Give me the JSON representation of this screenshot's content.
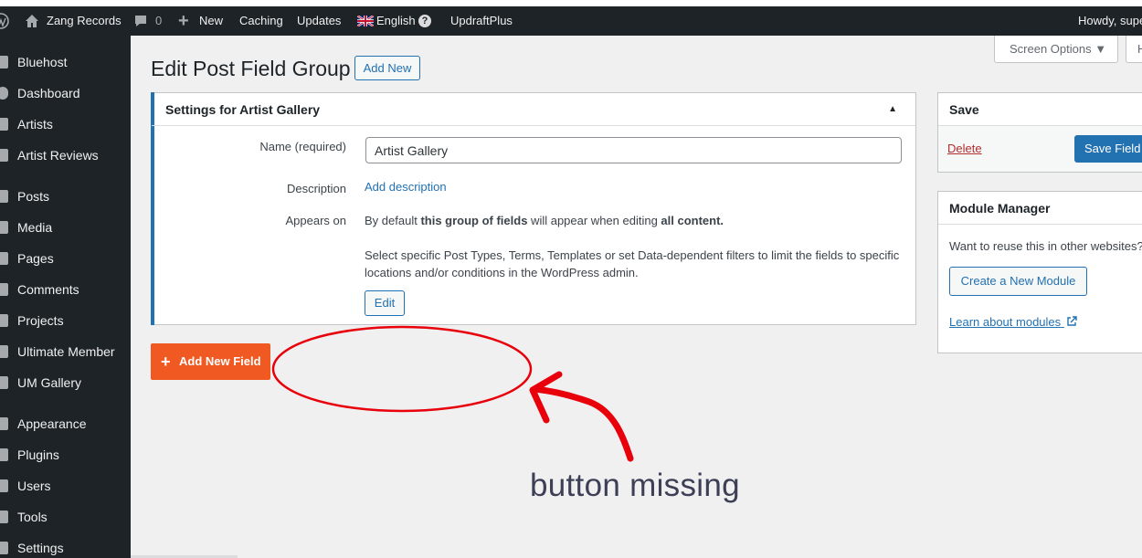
{
  "adminbar": {
    "site_name": "Zang Records",
    "comments_count": "0",
    "new_label": "New",
    "caching_label": "Caching",
    "updates_label": "Updates",
    "language_label": "English",
    "updraft_label": "UpdraftPlus",
    "howdy_label": "Howdy, supe"
  },
  "sidebar": {
    "items": [
      {
        "label": "Bluehost"
      },
      {
        "label": "Dashboard"
      },
      {
        "label": "Artists"
      },
      {
        "label": "Artist Reviews"
      },
      {
        "label": "Posts"
      },
      {
        "label": "Media"
      },
      {
        "label": "Pages"
      },
      {
        "label": "Comments"
      },
      {
        "label": "Projects"
      },
      {
        "label": "Ultimate Member"
      },
      {
        "label": "UM Gallery"
      },
      {
        "label": "Appearance"
      },
      {
        "label": "Plugins"
      },
      {
        "label": "Users"
      },
      {
        "label": "Tools"
      },
      {
        "label": "Settings"
      }
    ]
  },
  "header": {
    "screen_options": "Screen Options ▼",
    "help_partial": "H",
    "title": "Edit Post Field Group",
    "add_new": "Add New"
  },
  "settings": {
    "title": "Settings for Artist Gallery",
    "toggle": "▲",
    "name_label": "Name (required)",
    "name_value": "Artist Gallery",
    "description_label": "Description",
    "description_link": "Add description",
    "appears_on_label": "Appears on",
    "appears_pre": "By default ",
    "appears_bold1": "this group of fields",
    "appears_mid": " will appear when editing ",
    "appears_bold2": "all content.",
    "select_text": "Select specific Post Types, Terms, Templates or set Data-dependent filters to limit the fields to specific locations and/or conditions in the WordPress admin.",
    "edit_button": "Edit"
  },
  "add_field_button": "Add New Field",
  "save_box": {
    "title": "Save",
    "delete_link": "Delete",
    "save_button": "Save Field G"
  },
  "module_manager": {
    "title": "Module Manager",
    "question": "Want to reuse this in other websites?",
    "create_button": "Create a New Module",
    "learn_link": "Learn about modules"
  },
  "annotation": {
    "text": "button missing",
    "color": "#e8000b"
  }
}
